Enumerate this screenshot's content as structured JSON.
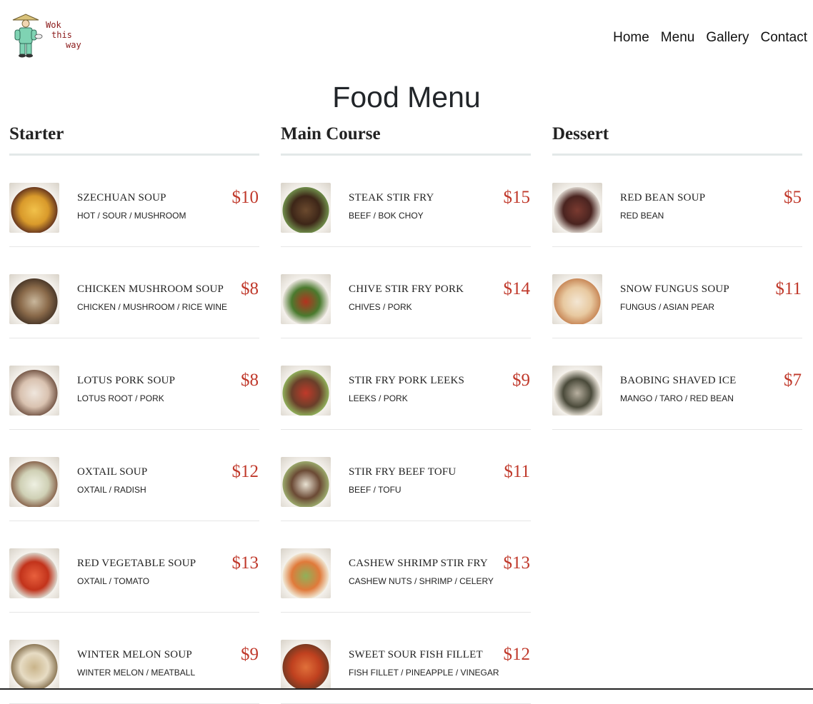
{
  "brand": {
    "logo_line1": "Wok",
    "logo_line2": "this",
    "logo_line3": "way"
  },
  "nav": {
    "items": [
      "Home",
      "Menu",
      "Gallery",
      "Contact"
    ]
  },
  "page_title": "Food Menu",
  "sections": [
    {
      "title": "Starter",
      "items": [
        {
          "name": "SZECHUAN SOUP",
          "desc": "HOT / SOUR / MUSHROOM",
          "price": "$10",
          "colors": [
            "#d99a2b",
            "#f1c14a",
            "#6b3a1f"
          ]
        },
        {
          "name": "CHICKEN MUSHROOM SOUP",
          "desc": "CHICKEN / MUSHROOM / RICE WINE",
          "price": "$8",
          "colors": [
            "#8a6a4a",
            "#c9b79c",
            "#4d3a2a"
          ]
        },
        {
          "name": "LOTUS PORK SOUP",
          "desc": "LOTUS ROOT / PORK",
          "price": "$8",
          "colors": [
            "#d9c2b0",
            "#efe6dd",
            "#7a5c4c"
          ]
        },
        {
          "name": "OXTAIL SOUP",
          "desc": "OXTAIL / RADISH",
          "price": "$12",
          "colors": [
            "#cfd0b5",
            "#eef0e2",
            "#8c6a52"
          ]
        },
        {
          "name": "RED VEGETABLE SOUP",
          "desc": "OXTAIL / TOMATO",
          "price": "$13",
          "colors": [
            "#c2331b",
            "#e8603d",
            "#d9d2c7"
          ]
        },
        {
          "name": "WINTER MELON SOUP",
          "desc": "WINTER MELON / MEATBALL",
          "price": "$9",
          "colors": [
            "#e7dcc4",
            "#c9b48a",
            "#8f7b5a"
          ]
        }
      ]
    },
    {
      "title": "Main Course",
      "items": [
        {
          "name": "STEAK STIR FRY",
          "desc": "BEEF / BOK CHOY",
          "price": "$15",
          "colors": [
            "#3d2618",
            "#6b4a2e",
            "#6f8c4a"
          ]
        },
        {
          "name": "CHIVE STIR FRY PORK",
          "desc": "CHIVES / PORK",
          "price": "$14",
          "colors": [
            "#4a7a2e",
            "#b3331f",
            "#e5e1d8"
          ]
        },
        {
          "name": "STIR FRY PORK LEEKS",
          "desc": "LEEKS / PORK",
          "price": "$9",
          "colors": [
            "#6a3f2a",
            "#c03a2a",
            "#8fae5a"
          ]
        },
        {
          "name": "STIR FRY BEEF TOFU",
          "desc": "BEEF / TOFU",
          "price": "$11",
          "colors": [
            "#6b4a35",
            "#e9e2d3",
            "#9aa86b"
          ]
        },
        {
          "name": "CASHEW SHRIMP STIR FRY",
          "desc": "CASHEW NUTS / SHRIMP / CELERY",
          "price": "$13",
          "colors": [
            "#e07a3a",
            "#8fb15a",
            "#f0e6d2"
          ]
        },
        {
          "name": "SWEET SOUR FISH FILLET",
          "desc": "FISH FILLET / PINEAPPLE / VINEGAR",
          "price": "$12",
          "colors": [
            "#c0411f",
            "#e0703a",
            "#7b3a22"
          ]
        }
      ]
    },
    {
      "title": "Dessert",
      "items": [
        {
          "name": "RED BEAN SOUP",
          "desc": "RED BEAN",
          "price": "$5",
          "colors": [
            "#4a2420",
            "#7a3a30",
            "#d8d0c8"
          ]
        },
        {
          "name": "SNOW FUNGUS SOUP",
          "desc": "FUNGUS / ASIAN PEAR",
          "price": "$11",
          "colors": [
            "#e8c9a0",
            "#f3e6d3",
            "#c98a5a"
          ]
        },
        {
          "name": "BAOBING SHAVED ICE",
          "desc": "MANGO / TARO / RED BEAN",
          "price": "$7",
          "colors": [
            "#4a4a3a",
            "#b8b0a0",
            "#e6e0d5"
          ]
        }
      ]
    }
  ]
}
